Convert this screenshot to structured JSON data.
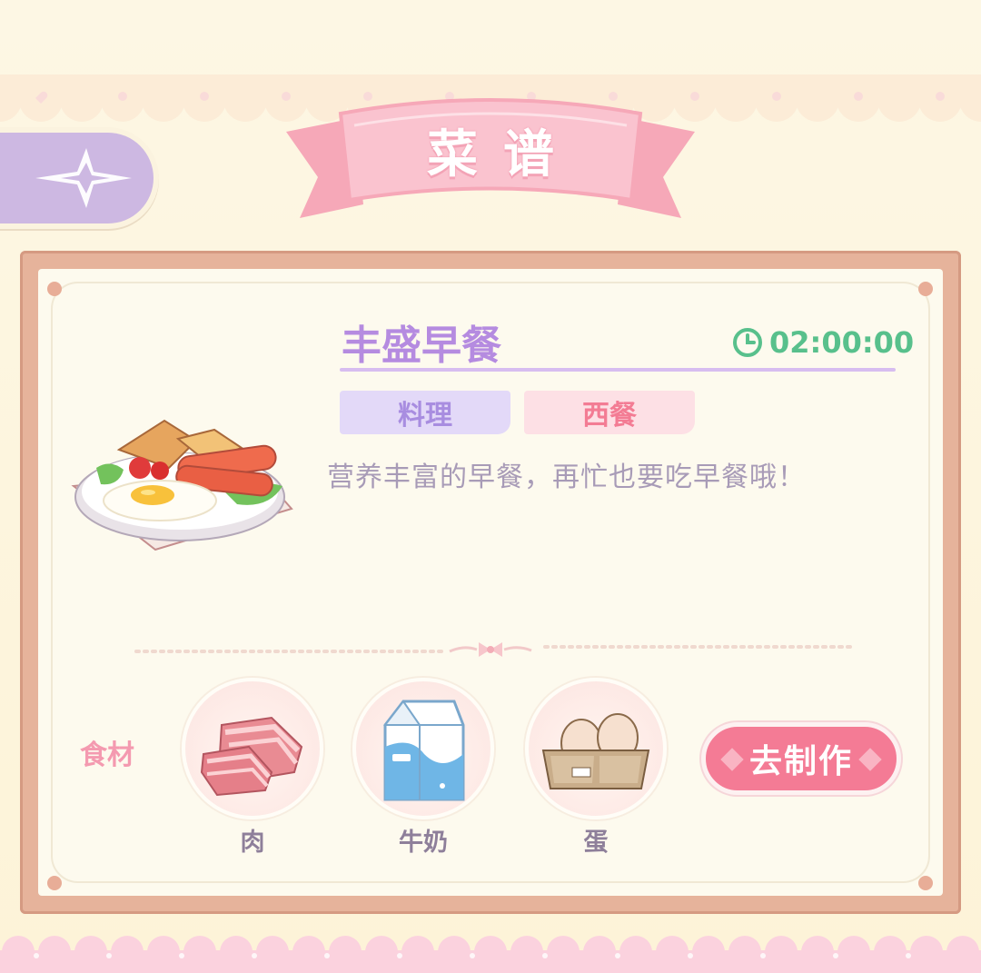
{
  "header": {
    "title": "菜谱",
    "back_icon": "four-point-star-back-icon"
  },
  "recipe": {
    "name": "丰盛早餐",
    "timer": "02:00:00",
    "tags": [
      "料理",
      "西餐"
    ],
    "description": "营养丰富的早餐，再忙也要吃早餐哦！",
    "image": "breakfast-plate-icon"
  },
  "ingredients": {
    "label": "食材",
    "items": [
      {
        "name": "肉",
        "icon": "meat-icon"
      },
      {
        "name": "牛奶",
        "icon": "milk-carton-icon"
      },
      {
        "name": "蛋",
        "icon": "egg-carton-icon"
      }
    ]
  },
  "actions": {
    "make_label": "去制作"
  },
  "colors": {
    "accent_purple": "#b58be0",
    "accent_pink": "#f47b95",
    "timer_green": "#58c08c",
    "frame": "#e6b39b"
  }
}
